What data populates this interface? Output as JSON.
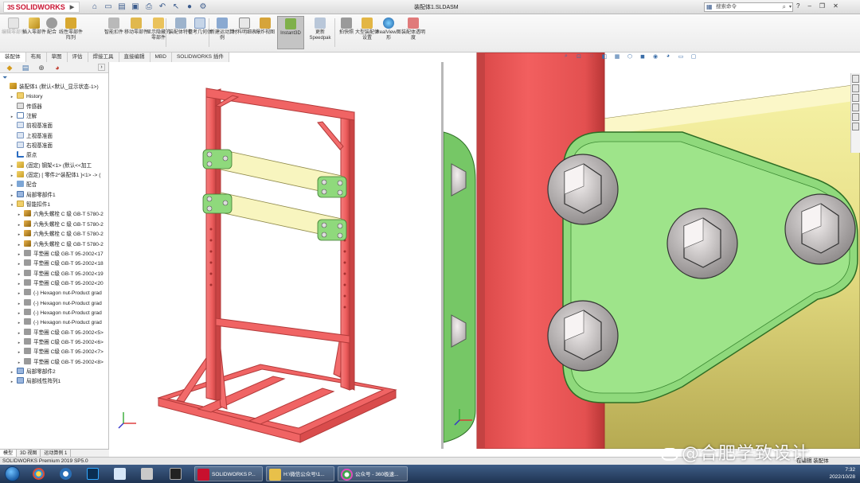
{
  "app": {
    "brand_prefix": "3S",
    "brand": "SOLIDWORKS",
    "document_title": "装配体1.SLDASM",
    "search_placeholder": "搜索命令"
  },
  "quick_access_icons": [
    "home-icon",
    "new-icon",
    "open-icon",
    "save-icon",
    "print-icon",
    "undo-icon",
    "select-icon",
    "rebuild-icon",
    "options-icon"
  ],
  "toolbar": {
    "commands": [
      {
        "label": "编辑零部件",
        "icon": "edit-component-icon",
        "enabled": false
      },
      {
        "label": "插入零部件",
        "icon": "insert-component-icon",
        "enabled": true
      },
      {
        "label": "配合",
        "icon": "mate-icon",
        "enabled": true
      },
      {
        "label": "线性零部件阵列",
        "icon": "linear-pattern-icon",
        "enabled": true
      },
      {
        "label": "智能扣件",
        "icon": "smart-fastener-icon",
        "enabled": true
      },
      {
        "label": "移动零部件",
        "icon": "move-component-icon",
        "enabled": true
      },
      {
        "label": "显示隐藏的零部件",
        "icon": "show-hidden-icon",
        "enabled": true
      },
      {
        "label": "装配体特征",
        "icon": "assembly-feature-icon",
        "enabled": true
      },
      {
        "label": "参考几何体",
        "icon": "reference-geometry-icon",
        "enabled": true
      },
      {
        "label": "新建运动算例",
        "icon": "motion-study-icon",
        "enabled": true
      },
      {
        "label": "材料明细表",
        "icon": "bom-icon",
        "enabled": true
      },
      {
        "label": "爆炸视图",
        "icon": "exploded-view-icon",
        "enabled": true
      },
      {
        "label": "Instant3D",
        "icon": "instant3d-icon",
        "enabled": true,
        "active": true
      },
      {
        "label": "更新Speedpak",
        "icon": "speedpak-icon",
        "enabled": true
      },
      {
        "label": "拍快照",
        "icon": "snapshot-icon",
        "enabled": true
      },
      {
        "label": "大型装配体设置",
        "icon": "large-assembly-icon",
        "enabled": true
      },
      {
        "label": "RealView图形",
        "icon": "realview-icon",
        "enabled": true
      },
      {
        "label": "装配体透明度",
        "icon": "transparency-icon",
        "enabled": true
      }
    ]
  },
  "tabs": [
    "装配体",
    "布局",
    "草图",
    "评估",
    "焊接工具",
    "直接编辑",
    "MBD",
    "SOLIDWORKS 插件"
  ],
  "feature_tree": {
    "items": [
      {
        "label": "装配体1 (默认<默认_显示状态-1>)",
        "icon": "assembly",
        "expander": "",
        "indent": 0
      },
      {
        "label": "History",
        "icon": "folder",
        "expander": "▸",
        "indent": 1
      },
      {
        "label": "传感器",
        "icon": "sensor",
        "expander": "",
        "indent": 1
      },
      {
        "label": "注解",
        "icon": "note",
        "expander": "▸",
        "indent": 1
      },
      {
        "label": "前视基准面",
        "icon": "plane",
        "expander": "",
        "indent": 1
      },
      {
        "label": "上视基准面",
        "icon": "plane",
        "expander": "",
        "indent": 1
      },
      {
        "label": "右视基准面",
        "icon": "plane",
        "expander": "",
        "indent": 1
      },
      {
        "label": "原点",
        "icon": "origin",
        "expander": "",
        "indent": 1
      },
      {
        "label": "(固定) 钢架<1> (默认<<加工",
        "icon": "part",
        "expander": "▸",
        "indent": 1
      },
      {
        "label": "(固定) [ 零件2^装配体1 ]<1> -> (",
        "icon": "part",
        "expander": "▸",
        "indent": 1
      },
      {
        "label": "配合",
        "icon": "mate",
        "expander": "▸",
        "indent": 1
      },
      {
        "label": "局部零部件1",
        "icon": "pattern",
        "expander": "▸",
        "indent": 1
      },
      {
        "label": "智能扣件1",
        "icon": "folder",
        "expander": "▾",
        "indent": 1
      },
      {
        "label": "六角头螺栓 C 级 GB-T 5780-2",
        "icon": "bolt",
        "expander": "▸",
        "indent": 2
      },
      {
        "label": "六角头螺栓 C 级 GB-T 5780-2",
        "icon": "bolt",
        "expander": "▸",
        "indent": 2
      },
      {
        "label": "六角头螺栓 C 级 GB-T 5780-2",
        "icon": "bolt",
        "expander": "▸",
        "indent": 2
      },
      {
        "label": "六角头螺栓 C 级 GB-T 5780-2",
        "icon": "bolt",
        "expander": "▸",
        "indent": 2
      },
      {
        "label": "平垫圈 C级 GB-T 95-2002<17",
        "icon": "fastener",
        "expander": "▸",
        "indent": 2
      },
      {
        "label": "平垫圈 C级 GB-T 95-2002<18",
        "icon": "fastener",
        "expander": "▸",
        "indent": 2
      },
      {
        "label": "平垫圈 C级 GB-T 95-2002<19",
        "icon": "fastener",
        "expander": "▸",
        "indent": 2
      },
      {
        "label": "平垫圈 C级 GB-T 95-2002<20",
        "icon": "fastener",
        "expander": "▸",
        "indent": 2
      },
      {
        "label": "(-) Hexagon nut-Product grad",
        "icon": "fastener",
        "expander": "▸",
        "indent": 2
      },
      {
        "label": "(-) Hexagon nut-Product grad",
        "icon": "fastener",
        "expander": "▸",
        "indent": 2
      },
      {
        "label": "(-) Hexagon nut-Product grad",
        "icon": "fastener",
        "expander": "▸",
        "indent": 2
      },
      {
        "label": "(-) Hexagon nut-Product grad",
        "icon": "fastener",
        "expander": "▸",
        "indent": 2
      },
      {
        "label": "平垫圈 C级 GB-T 95-2002<5>",
        "icon": "fastener",
        "expander": "▸",
        "indent": 2
      },
      {
        "label": "平垫圈 C级 GB-T 95-2002<6>",
        "icon": "fastener",
        "expander": "▸",
        "indent": 2
      },
      {
        "label": "平垫圈 C级 GB-T 95-2002<7>",
        "icon": "fastener",
        "expander": "▸",
        "indent": 2
      },
      {
        "label": "平垫圈 C级 GB-T 95-2002<8>",
        "icon": "fastener",
        "expander": "▸",
        "indent": 2
      },
      {
        "label": "局部零部件2",
        "icon": "pattern",
        "expander": "▸",
        "indent": 1
      },
      {
        "label": "局部线性阵列1",
        "icon": "pattern",
        "expander": "▸",
        "indent": 1
      }
    ]
  },
  "bottom_tabs": [
    "模型",
    "3D 视图",
    "运动算例 1"
  ],
  "status": {
    "left": "SOLIDWORKS Premium 2019 SP5.0",
    "right": "在编辑 装配体"
  },
  "taskbar": {
    "windows": [
      {
        "label": "SOLIDWORKS P...",
        "icon": "solidworks-icon",
        "color": "#c8102e"
      },
      {
        "label": "H:\\微信公众号\\1...",
        "icon": "folder-icon",
        "color": "#e8c04a"
      },
      {
        "label": "公众号 - 360极速...",
        "icon": "browser-icon",
        "color": "#3fa34d"
      }
    ],
    "time": "7:32",
    "date": "2022/10/28"
  },
  "watermark": "@合肥学致设计",
  "colors": {
    "frame": "#f26b6b",
    "frame_dark": "#c44545",
    "plate": "#f4f2b0",
    "bracket": "#8cd47c",
    "bolt": "#d9d5d6"
  }
}
